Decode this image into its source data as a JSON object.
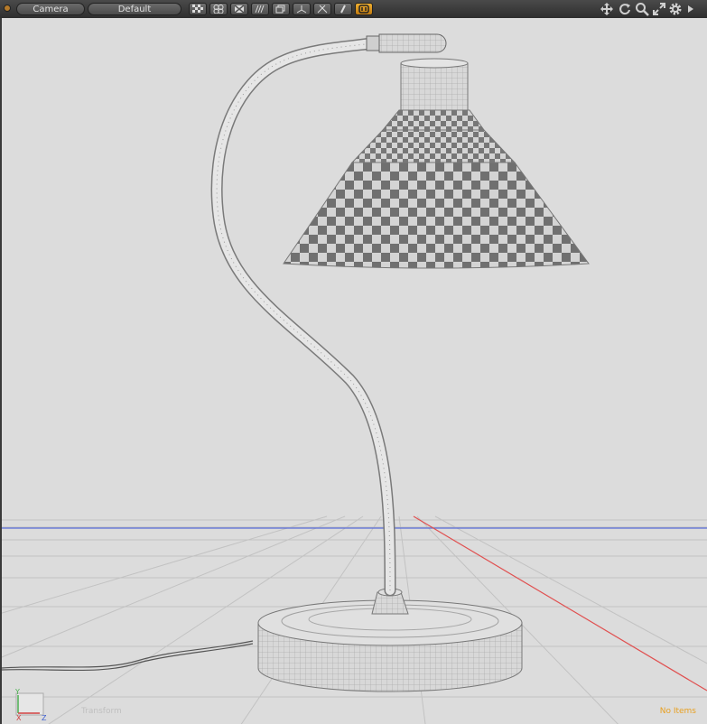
{
  "toolbar": {
    "camera_label": "Camera",
    "shading_label": "Default",
    "view_buttons": [
      {
        "icon": "checker-icon"
      },
      {
        "icon": "spheres-icon"
      },
      {
        "icon": "x-wire-icon"
      },
      {
        "icon": "stripes-icon"
      },
      {
        "icon": "layers-icon"
      },
      {
        "icon": "axis-icon"
      },
      {
        "icon": "joint-icon"
      },
      {
        "icon": "link-icon"
      },
      {
        "icon": "texture-icon"
      }
    ],
    "active_button": "texture-icon",
    "nav_icons": [
      "move-view-icon",
      "rotate-view-icon",
      "zoom-view-icon",
      "fit-view-icon",
      "settings-icon",
      "play-icon"
    ]
  },
  "viewport": {
    "tool_label": "Transform",
    "status_label": "No Items",
    "axis_labels": {
      "y": "Y",
      "x": "X",
      "z": "Z"
    }
  },
  "colors": {
    "background": "#dcdcdc",
    "grid": "#bfbfbf",
    "x_axis": "#e05050",
    "horizon": "#5a6cd8",
    "status_accent": "#e8a020"
  }
}
